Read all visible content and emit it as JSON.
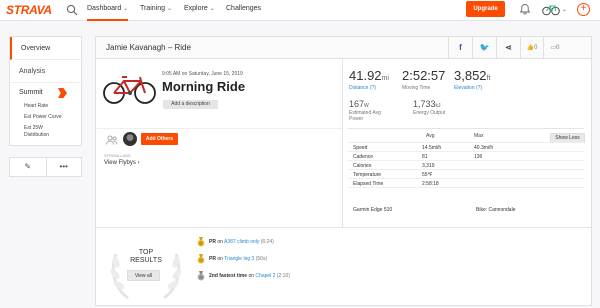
{
  "topnav": {
    "logo": "STRAVA",
    "items": [
      {
        "label": "Dashboard",
        "active": true
      },
      {
        "label": "Training"
      },
      {
        "label": "Explore"
      },
      {
        "label": "Challenges"
      }
    ],
    "upgrade_label": "Upgrade"
  },
  "sidebar": {
    "items": [
      {
        "label": "Overview",
        "active": true
      },
      {
        "label": "Analysis"
      },
      {
        "label": "Summit"
      }
    ],
    "sub_items": [
      "Heart Rate",
      "Est Power Curve",
      "Est 25W\nDistribution"
    ],
    "tools": [
      "pencil-icon",
      "more-icon"
    ]
  },
  "header": {
    "title": "Jamie Kavanagh – Ride",
    "kudos_count": "0",
    "comments_count": "0"
  },
  "activity": {
    "date": "9:05 AM on Saturday, June 15, 2019",
    "title": "Morning Ride",
    "description_button": "Add a description",
    "add_others": "Add Others",
    "flyby_label": "STRAVA LABS",
    "flyby_link": "View Flybys ›"
  },
  "stats": {
    "distance": {
      "value": "41.92",
      "unit": "mi",
      "label": "Distance (?)"
    },
    "moving_time": {
      "value": "2:52:57",
      "label": "Moving Time"
    },
    "elevation": {
      "value": "3,852",
      "unit": "ft",
      "label": "Elevation (?)"
    },
    "power": {
      "value": "167",
      "unit": "W",
      "label": "Estimated Avg Power"
    },
    "energy": {
      "value": "1,733",
      "unit": "kJ",
      "label": "Energy Output"
    }
  },
  "table": {
    "headers": {
      "avg": "Avg",
      "max": "Max"
    },
    "show_less": "Show Less",
    "rows": [
      {
        "label": "Speed",
        "avg": "14.5mi/h",
        "max": "40.3mi/h"
      },
      {
        "label": "Cadence",
        "avg": "81",
        "max": "136"
      },
      {
        "label": "Calories",
        "avg": "3,319",
        "max": ""
      },
      {
        "label": "Temperature",
        "avg": "55℉",
        "max": ""
      },
      {
        "label": "Elapsed Time",
        "avg": "2:58:18",
        "max": ""
      }
    ],
    "device": "Garmin Edge 510",
    "bike": "Bike: Cannondale"
  },
  "results": {
    "title": "TOP\nRESULTS",
    "view_all": "View all",
    "achievements": [
      {
        "rank": "PR",
        "pre": " on ",
        "segment": "A387 climb only",
        "time": " (6:24)",
        "medal": "gold"
      },
      {
        "rank": "PR",
        "pre": " on ",
        "segment": "Triangle leg 3",
        "time": " (50s)",
        "medal": "gold"
      },
      {
        "rank": "2nd fastest time",
        "pre": " on ",
        "segment": "Chapel 2",
        "time": " (2:10)",
        "medal": "silver"
      }
    ]
  }
}
